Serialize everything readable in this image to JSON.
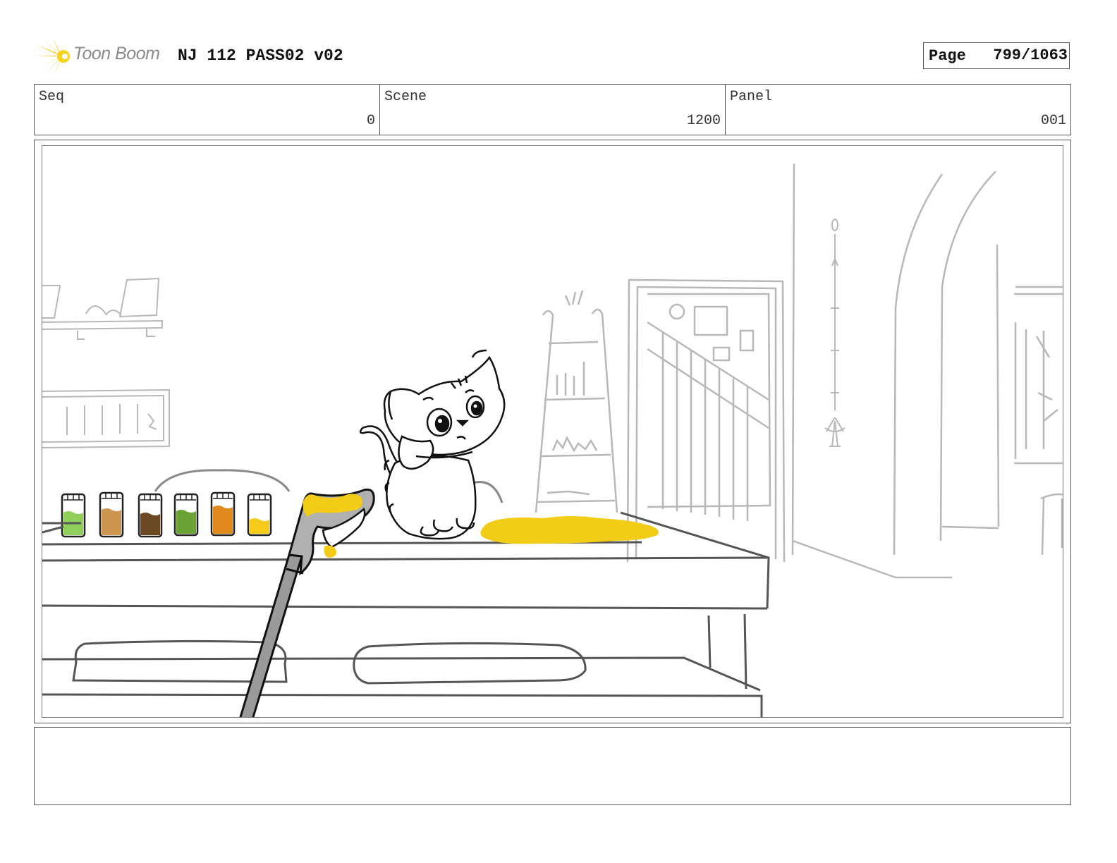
{
  "header": {
    "logo_text": "Toon Boom",
    "doc_title": "NJ 112 PASS02 v02",
    "page_label": "Page",
    "page_number": "799/1063"
  },
  "info": {
    "seq_label": "Seq",
    "seq_value": "0",
    "scene_label": "Scene",
    "scene_value": "1200",
    "panel_label": "Panel",
    "panel_value": "001"
  },
  "panel_art": {
    "jar_colors": [
      "#8fcf5a",
      "#cc9550",
      "#6b4a23",
      "#6aa335",
      "#e08a1e",
      "#f5cc1a"
    ],
    "spill_color": "#f2cc16",
    "tool_accent": "#f2cc16"
  },
  "notes": {
    "text": ""
  }
}
